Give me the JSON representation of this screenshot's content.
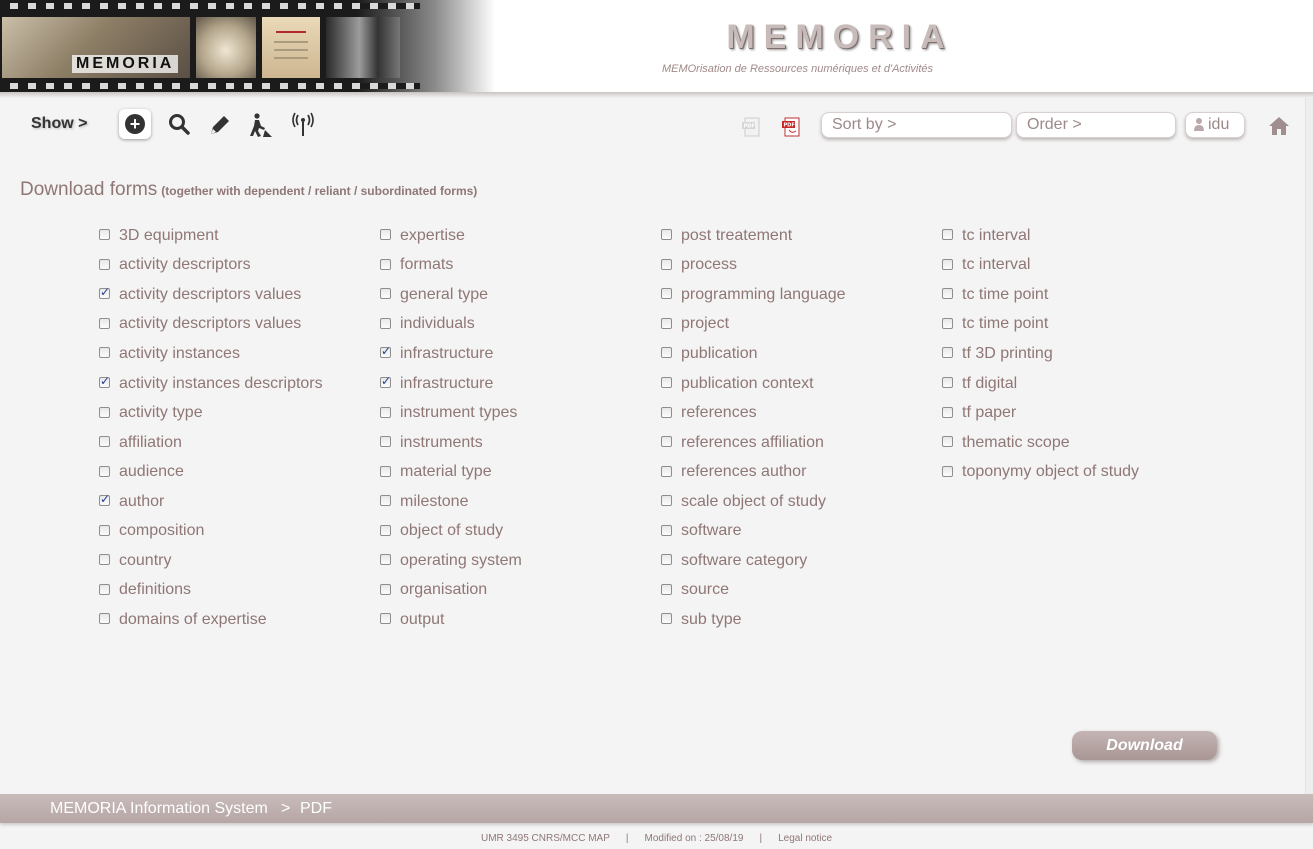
{
  "header": {
    "banner_text": "MEMORIA",
    "title": "MEMORIA",
    "subtitle": "MEMOrisation de Ressources numériques et d'Activités"
  },
  "toolbar": {
    "show_label": "Show >",
    "icons": [
      "add-icon",
      "search-icon",
      "edit-icon",
      "worker-icon",
      "broadcast-icon",
      "pdf-disabled-icon",
      "pdf-icon"
    ],
    "sort_label": "Sort by  >",
    "order_label": "Order  >",
    "user_label": "idu",
    "home_icon": "home-icon"
  },
  "section": {
    "title": "Download forms",
    "subtitle": "(together with dependent / reliant / subordinated forms)"
  },
  "forms": {
    "col1": [
      {
        "label": "3D equipment",
        "checked": false
      },
      {
        "label": "activity descriptors",
        "checked": false
      },
      {
        "label": "activity descriptors values",
        "checked": true
      },
      {
        "label": "activity descriptors values",
        "checked": false
      },
      {
        "label": "activity instances",
        "checked": false
      },
      {
        "label": "activity instances descriptors",
        "checked": true
      },
      {
        "label": "activity type",
        "checked": false
      },
      {
        "label": "affiliation",
        "checked": false
      },
      {
        "label": "audience",
        "checked": false
      },
      {
        "label": "author",
        "checked": true
      },
      {
        "label": "composition",
        "checked": false
      },
      {
        "label": "country",
        "checked": false
      },
      {
        "label": "definitions",
        "checked": false
      },
      {
        "label": "domains of expertise",
        "checked": false
      }
    ],
    "col2": [
      {
        "label": "expertise",
        "checked": false
      },
      {
        "label": "formats",
        "checked": false
      },
      {
        "label": "general type",
        "checked": false
      },
      {
        "label": "individuals",
        "checked": false
      },
      {
        "label": "infrastructure",
        "checked": true
      },
      {
        "label": "infrastructure",
        "checked": true
      },
      {
        "label": "instrument types",
        "checked": false
      },
      {
        "label": "instruments",
        "checked": false
      },
      {
        "label": "material type",
        "checked": false
      },
      {
        "label": "milestone",
        "checked": false
      },
      {
        "label": "object of study",
        "checked": false
      },
      {
        "label": "operating system",
        "checked": false
      },
      {
        "label": "organisation",
        "checked": false
      },
      {
        "label": "output",
        "checked": false
      }
    ],
    "col3": [
      {
        "label": "post treatement",
        "checked": false
      },
      {
        "label": "process",
        "checked": false
      },
      {
        "label": "programming language",
        "checked": false
      },
      {
        "label": "project",
        "checked": false
      },
      {
        "label": "publication",
        "checked": false
      },
      {
        "label": "publication context",
        "checked": false
      },
      {
        "label": "references",
        "checked": false
      },
      {
        "label": "references affiliation",
        "checked": false
      },
      {
        "label": "references author",
        "checked": false
      },
      {
        "label": "scale object of study",
        "checked": false
      },
      {
        "label": "software",
        "checked": false
      },
      {
        "label": "software category",
        "checked": false
      },
      {
        "label": "source",
        "checked": false
      },
      {
        "label": "sub type",
        "checked": false
      }
    ],
    "col4": [
      {
        "label": "tc interval",
        "checked": false
      },
      {
        "label": "tc interval",
        "checked": false
      },
      {
        "label": "tc time point",
        "checked": false
      },
      {
        "label": "tc time point",
        "checked": false
      },
      {
        "label": "tf 3D printing",
        "checked": false
      },
      {
        "label": "tf digital",
        "checked": false
      },
      {
        "label": "tf paper",
        "checked": false
      },
      {
        "label": "thematic scope",
        "checked": false
      },
      {
        "label": "toponymy object of study",
        "checked": false
      }
    ]
  },
  "download_label": "Download",
  "footer": {
    "breadcrumb": [
      "MEMORIA  Information System",
      ">",
      "PDF"
    ],
    "org": "UMR 3495 CNRS/MCC MAP",
    "sep": "|",
    "modified": "Modified on : 25/08/19",
    "legal": "Legal notice"
  },
  "colors": {
    "accent": "#8f7776",
    "footer_bar": "#bfb1b0",
    "check": "#233d8f"
  }
}
